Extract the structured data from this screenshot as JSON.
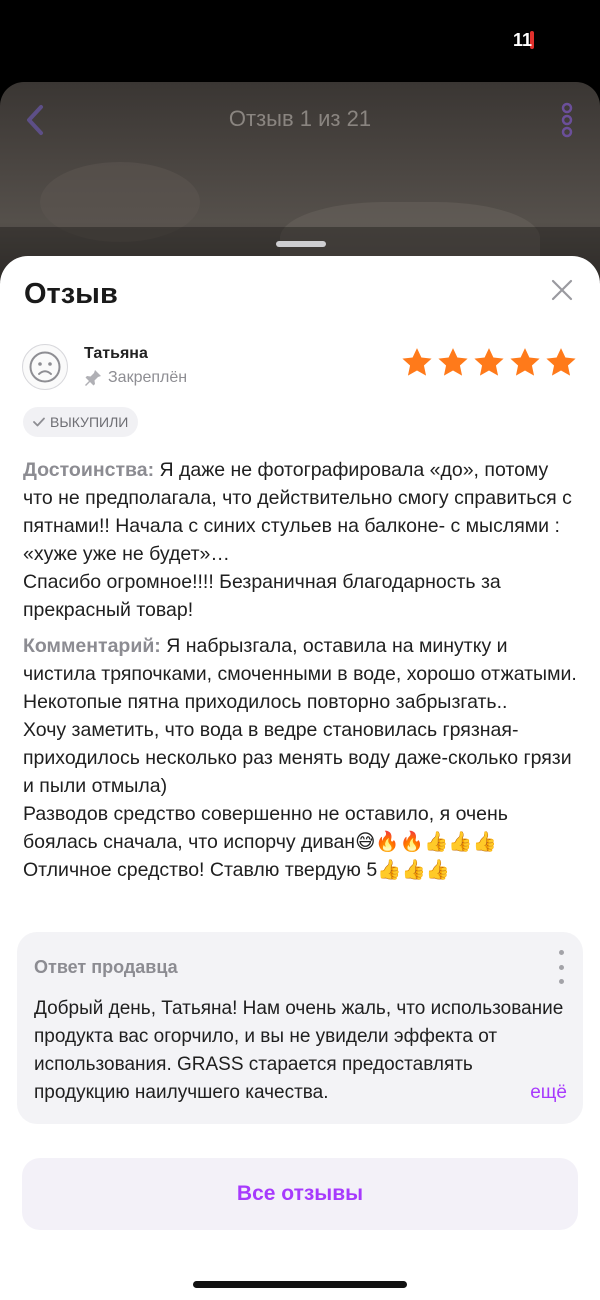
{
  "status_bar": {
    "battery_level": "11",
    "battery_color": "#e0302c"
  },
  "viewer": {
    "title": "Отзыв 1 из 21"
  },
  "sheet": {
    "title": "Отзыв"
  },
  "review": {
    "author": "Татьяна",
    "pinned_label": "Закреплён",
    "rating": 5,
    "rating_max": 5,
    "star_color": "#ff7a1a",
    "badge_label": "ВЫКУПИЛИ",
    "advantages_label": "Достоинства:",
    "advantages_text": " Я даже не фотографировала «до», потому что не предполагала, что действительно смогу справиться с пятнами!! Начала с синих стульев на балконе- с мыслями : «хуже уже не будет»…\nСпасибо огромное!!!! Безраничная благодарность за прекрасный товар!",
    "comment_label": "Комментарий:",
    "comment_text": " Я набрызгала, оставила на минутку и чистила тряпочками, смоченными в воде, хорошо отжатыми.\nНекотопые пятна приходилось повторно забрызгать..\nХочу заметить, что вода в ведре становилась грязная- приходилось несколько раз менять воду даже-сколько грязи и пыли отмыла)\nРазводов средство совершенно не оставило, я очень боялась сначала, что испорчу диван😅🔥🔥👍👍👍\nОтличное средство! Ставлю твердую 5👍👍👍"
  },
  "seller_reply": {
    "title": "Ответ продавца",
    "text": "Добрый день, Татьяна! Нам очень жаль, что использование продукта вас огорчило, и вы не увидели эффекта от использования. GRASS старается предоставлять продукцию наилучшего качества.",
    "more_label": "ещё"
  },
  "all_reviews_button": "Все отзывы",
  "accent_color": "#a73afd"
}
